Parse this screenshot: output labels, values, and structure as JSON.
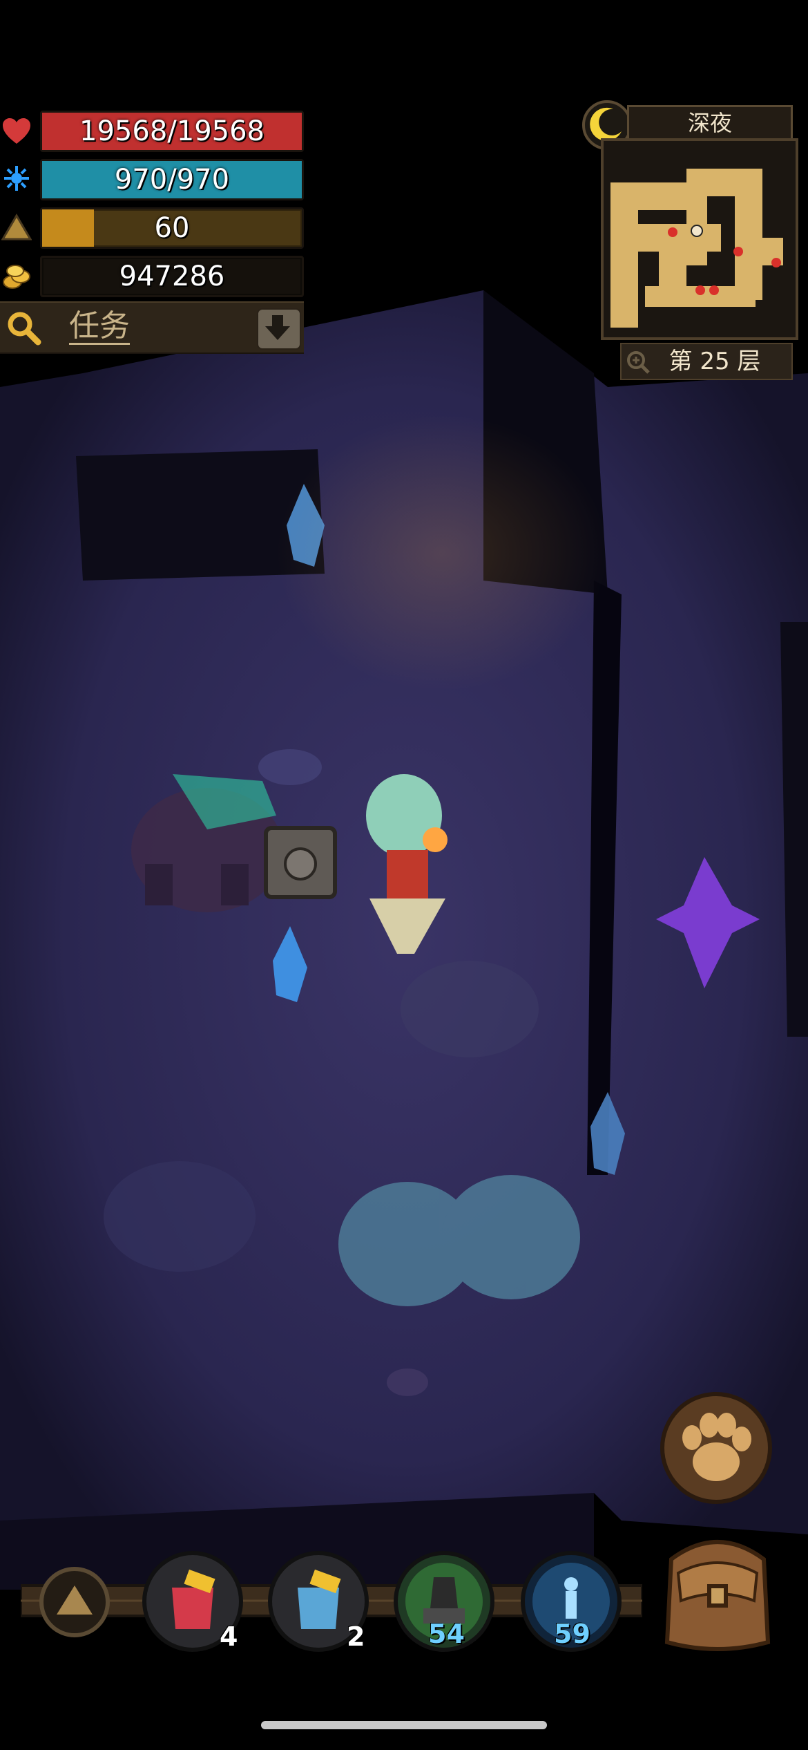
{
  "hud": {
    "hp": {
      "text": "19568/19568",
      "fraction": 1.0,
      "color": "#c0302f",
      "icon": "heart-icon"
    },
    "mp": {
      "text": "970/970",
      "fraction": 1.0,
      "color": "#1f8fa6",
      "icon": "mana-icon"
    },
    "level": {
      "text": "60",
      "fraction": 0.2,
      "color": "#c58a1c",
      "icon": "experience-triangle-icon"
    },
    "gold": {
      "text": "947286",
      "icon": "gold-coins-icon"
    }
  },
  "quest": {
    "label": "任务",
    "search_icon": "magnifier-icon",
    "toggle_icon": "arrow-down-icon"
  },
  "map": {
    "time_of_day": "深夜",
    "time_icon": "crescent-moon-icon",
    "floor": "第 25 层",
    "zoom_icon": "zoom-in-icon"
  },
  "hotbar": {
    "expand_icon": "triangle-up-icon",
    "slots": [
      {
        "name": "red-potion",
        "icon": "red-potion-icon",
        "count": "4"
      },
      {
        "name": "blue-potion",
        "icon": "blue-potion-icon",
        "count": "2"
      },
      {
        "name": "green-hand-skill",
        "icon": "green-hand-skill-icon",
        "count": "54"
      },
      {
        "name": "blue-figure-skill",
        "icon": "blue-figure-skill-icon",
        "count": "59"
      }
    ],
    "paw_icon": "paw-print-icon",
    "backpack_icon": "backpack-icon"
  },
  "colors": {
    "cave_floor": "#2c2850",
    "hud_dark": "#1a140e",
    "accent_gold": "#c58a1c"
  }
}
